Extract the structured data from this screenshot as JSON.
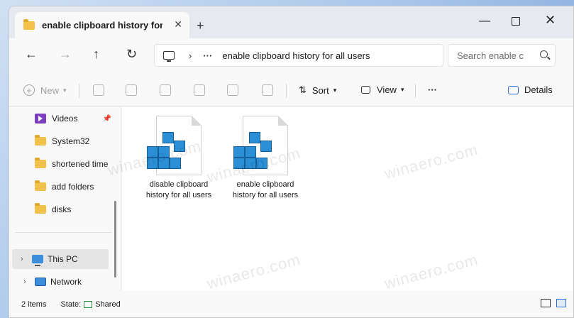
{
  "tab": {
    "title": "enable clipboard history for al",
    "close": "✕",
    "new_tab": "+"
  },
  "window_controls": {
    "minimize": "—",
    "close": "✕"
  },
  "nav": {
    "back": "←",
    "forward": "→",
    "up": "↑",
    "refresh": "↻"
  },
  "address": {
    "chevron": "›",
    "ellipsis": "···",
    "path": "enable clipboard history for all users"
  },
  "search": {
    "placeholder": "Search enable c"
  },
  "toolbar": {
    "new_label": "New",
    "sort_label": "Sort",
    "view_label": "View",
    "more_label": "···",
    "details_label": "Details"
  },
  "sidebar": {
    "items": [
      {
        "label": "Videos"
      },
      {
        "label": "System32"
      },
      {
        "label": "shortened time"
      },
      {
        "label": "add folders"
      },
      {
        "label": "disks"
      }
    ],
    "this_pc": "This PC",
    "network": "Network",
    "expand": "›",
    "pin": "📌"
  },
  "files": [
    {
      "name": "disable clipboard history for all users"
    },
    {
      "name": "enable clipboard history for all users"
    }
  ],
  "status": {
    "count": "2 items",
    "state_label": "State:",
    "state_value": "Shared"
  },
  "watermark": "winaero.com",
  "colors": {
    "accent": "#2a6ed6",
    "folder": "#f3c14a",
    "registry_blue": "#2b8fd6"
  }
}
